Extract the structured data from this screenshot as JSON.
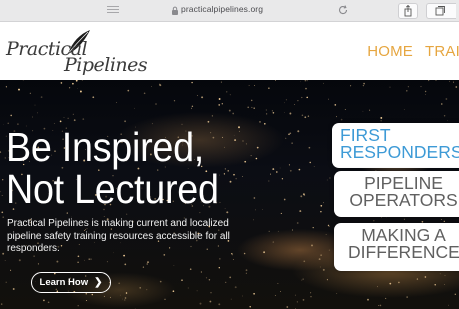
{
  "browser": {
    "url": "practicalpipelines.org"
  },
  "header": {
    "logo_text": "Practical Pipelines",
    "nav": [
      "HOME",
      "TRAIN"
    ]
  },
  "hero": {
    "title_line1": "Be Inspired,",
    "title_line2": "Not Lectured",
    "description": "Practical Pipelines is making current and localized pipeline safety training resources accessible for all responders.",
    "cta_label": "Learn How",
    "tiles": [
      {
        "line1": "FIRST",
        "line2": "RESPONDERS"
      },
      {
        "line1": "PIPELINE",
        "line2": "OPERATORS"
      },
      {
        "line1": "MAKING A",
        "line2": "DIFFERENCE!"
      }
    ]
  },
  "colors": {
    "nav": "#e6a640",
    "tile_highlight": "#3d9ad6",
    "tile_text": "#606060"
  },
  "icons": [
    "reader-icon",
    "lock-icon",
    "reload-icon",
    "share-icon",
    "tabs-icon",
    "leaf-icon",
    "chevron-right-icon"
  ]
}
